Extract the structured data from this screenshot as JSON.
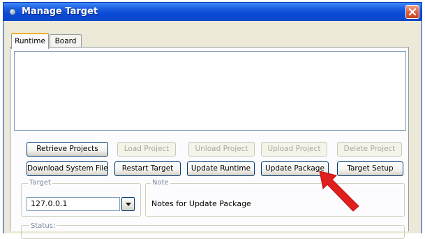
{
  "window": {
    "title": "Manage Target"
  },
  "tabs": [
    {
      "label": "Runtime",
      "active": true
    },
    {
      "label": "Board",
      "active": false
    }
  ],
  "buttons_row1": [
    {
      "label": "Retrieve Projects",
      "enabled": true
    },
    {
      "label": "Load Project",
      "enabled": false
    },
    {
      "label": "Unload Project",
      "enabled": false
    },
    {
      "label": "Upload Project",
      "enabled": false
    },
    {
      "label": "Delete Project",
      "enabled": false
    }
  ],
  "buttons_row2": [
    {
      "label": "Download System Files",
      "enabled": true
    },
    {
      "label": "Restart Target",
      "enabled": true
    },
    {
      "label": "Update Runtime",
      "enabled": true
    },
    {
      "label": "Update Package",
      "enabled": true
    },
    {
      "label": "Target Setup",
      "enabled": true
    }
  ],
  "target": {
    "label": "Target",
    "value": "127.0.0.1"
  },
  "note": {
    "label": "Note",
    "text": "Notes for Update Package"
  },
  "status": {
    "label": "Status:"
  },
  "colors": {
    "titlebar": "#0a49d6",
    "close": "#e0623d",
    "annotation_arrow": "#e01f1f"
  },
  "icons": {
    "app": "app-icon",
    "close": "close-icon",
    "dropdown": "chevron-down-icon",
    "annotation": "red-arrow-icon"
  }
}
